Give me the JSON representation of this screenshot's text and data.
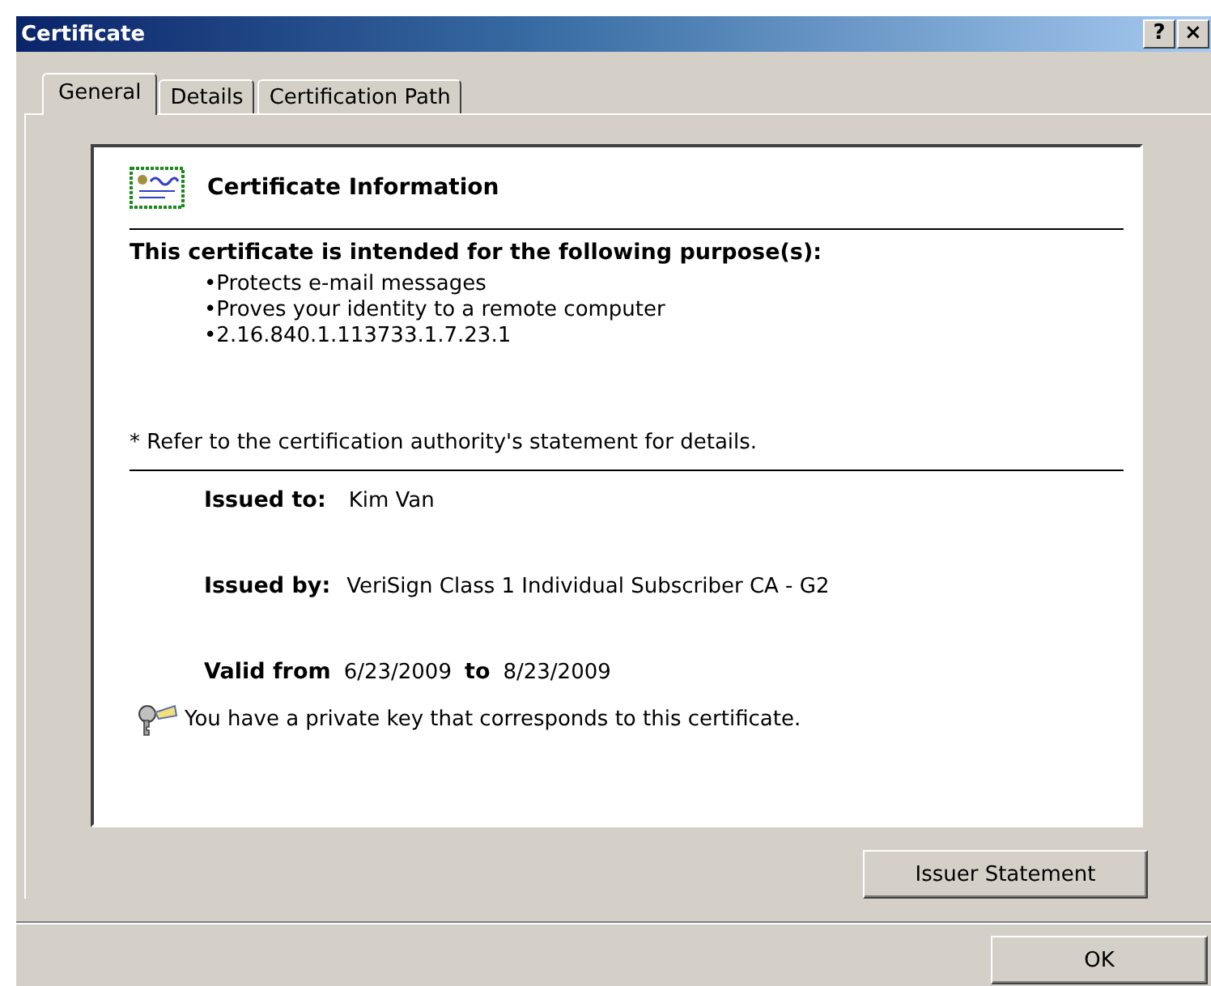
{
  "window": {
    "title": "Certificate",
    "buttons": [
      "?",
      "×"
    ]
  },
  "tabs": [
    {
      "label": "General",
      "selected": true
    },
    {
      "label": "Details",
      "selected": false
    },
    {
      "label": "Certification Path",
      "selected": false
    }
  ],
  "info": {
    "heading": "Certificate Information",
    "purpose_heading": "This certificate is intended for the following purpose(s):",
    "purposes": [
      "•Protects e-mail messages",
      "•Proves your identity to a remote computer",
      "•2.16.840.1.113733.1.7.23.1"
    ],
    "note": "* Refer to the certification authority's statement for details.",
    "issued_to": {
      "label": "Issued to:",
      "value": "Kim Van"
    },
    "issued_by": {
      "label": "Issued by:",
      "value": "VeriSign Class 1 Individual Subscriber CA - G2"
    },
    "validity": {
      "from_label": "Valid from",
      "from": "6/23/2009",
      "to_label": "to",
      "to": "8/23/2009"
    },
    "key_note": "You have a private key that corresponds to this certificate."
  },
  "issuer_button": "Issuer Statement",
  "buttons": [
    "OK"
  ]
}
